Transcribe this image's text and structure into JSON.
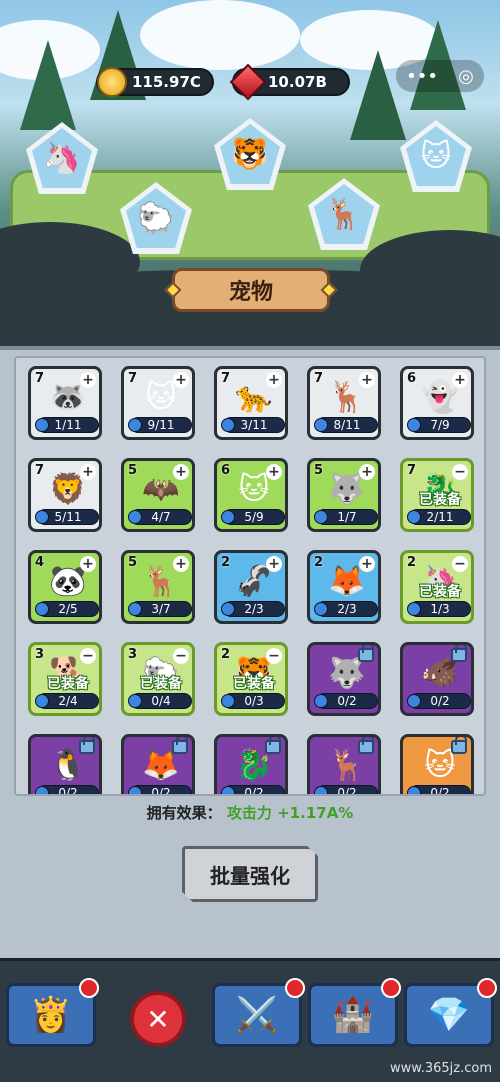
{
  "hud": {
    "coins": "115.97C",
    "gems": "10.07B"
  },
  "header": {
    "title": "宠物"
  },
  "pets_equipped_top": [
    "🦄",
    "🐑",
    "🐯",
    "🦌",
    "🐱"
  ],
  "grid": [
    {
      "level": "7",
      "progress": "1/11",
      "tier": "white",
      "icon": "🦝",
      "state": "plus"
    },
    {
      "level": "7",
      "progress": "9/11",
      "tier": "white",
      "icon": "🐱",
      "state": "plus"
    },
    {
      "level": "7",
      "progress": "3/11",
      "tier": "white",
      "icon": "🐆",
      "state": "plus"
    },
    {
      "level": "7",
      "progress": "8/11",
      "tier": "white",
      "icon": "🦌",
      "state": "plus"
    },
    {
      "level": "6",
      "progress": "7/9",
      "tier": "white",
      "icon": "👻",
      "state": "plus"
    },
    {
      "level": "7",
      "progress": "5/11",
      "tier": "white",
      "icon": "🦁",
      "state": "plus"
    },
    {
      "level": "5",
      "progress": "4/7",
      "tier": "green",
      "icon": "🦇",
      "state": "plus"
    },
    {
      "level": "6",
      "progress": "5/9",
      "tier": "green",
      "icon": "🐱",
      "state": "plus"
    },
    {
      "level": "5",
      "progress": "1/7",
      "tier": "green",
      "icon": "🐺",
      "state": "plus"
    },
    {
      "level": "7",
      "progress": "2/11",
      "tier": "equip",
      "icon": "🐉",
      "state": "minus",
      "equipped": "已装备"
    },
    {
      "level": "4",
      "progress": "2/5",
      "tier": "green",
      "icon": "🐼",
      "state": "plus"
    },
    {
      "level": "5",
      "progress": "3/7",
      "tier": "green",
      "icon": "🦌",
      "state": "plus"
    },
    {
      "level": "2",
      "progress": "2/3",
      "tier": "blue",
      "icon": "🦨",
      "state": "plus"
    },
    {
      "level": "2",
      "progress": "2/3",
      "tier": "blue",
      "icon": "🦊",
      "state": "plus"
    },
    {
      "level": "2",
      "progress": "1/3",
      "tier": "equip",
      "icon": "🦄",
      "state": "minus",
      "equipped": "已装备"
    },
    {
      "level": "3",
      "progress": "2/4",
      "tier": "equip",
      "icon": "🐕",
      "state": "minus",
      "equipped": "已装备"
    },
    {
      "level": "3",
      "progress": "0/4",
      "tier": "equip",
      "icon": "🐑",
      "state": "minus",
      "equipped": "已装备"
    },
    {
      "level": "2",
      "progress": "0/3",
      "tier": "equip",
      "icon": "🐯",
      "state": "minus",
      "equipped": "已装备"
    },
    {
      "level": "",
      "progress": "0/2",
      "tier": "purple",
      "icon": "🐺",
      "state": "lock"
    },
    {
      "level": "",
      "progress": "0/2",
      "tier": "purple",
      "icon": "🐗",
      "state": "lock"
    },
    {
      "level": "",
      "progress": "0/2",
      "tier": "purple",
      "icon": "🐧",
      "state": "lock"
    },
    {
      "level": "",
      "progress": "0/2",
      "tier": "purple",
      "icon": "🦊",
      "state": "lock"
    },
    {
      "level": "",
      "progress": "0/2",
      "tier": "purple",
      "icon": "🐉",
      "state": "lock"
    },
    {
      "level": "",
      "progress": "0/2",
      "tier": "purple",
      "icon": "🦌",
      "state": "lock"
    },
    {
      "level": "",
      "progress": "0/2",
      "tier": "orange",
      "icon": "🐱",
      "state": "lock"
    }
  ],
  "effect": {
    "label": "拥有效果：",
    "value": "攻击力 +1.17A%"
  },
  "batch_button": "批量强化",
  "bottom_tabs": [
    {
      "name": "hero",
      "icon": "👸"
    },
    {
      "name": "weapons",
      "icon": "⚔️"
    },
    {
      "name": "castle",
      "icon": "🏰"
    },
    {
      "name": "gem-shop",
      "icon": "💎"
    }
  ],
  "watermark": "www.365jz.com"
}
